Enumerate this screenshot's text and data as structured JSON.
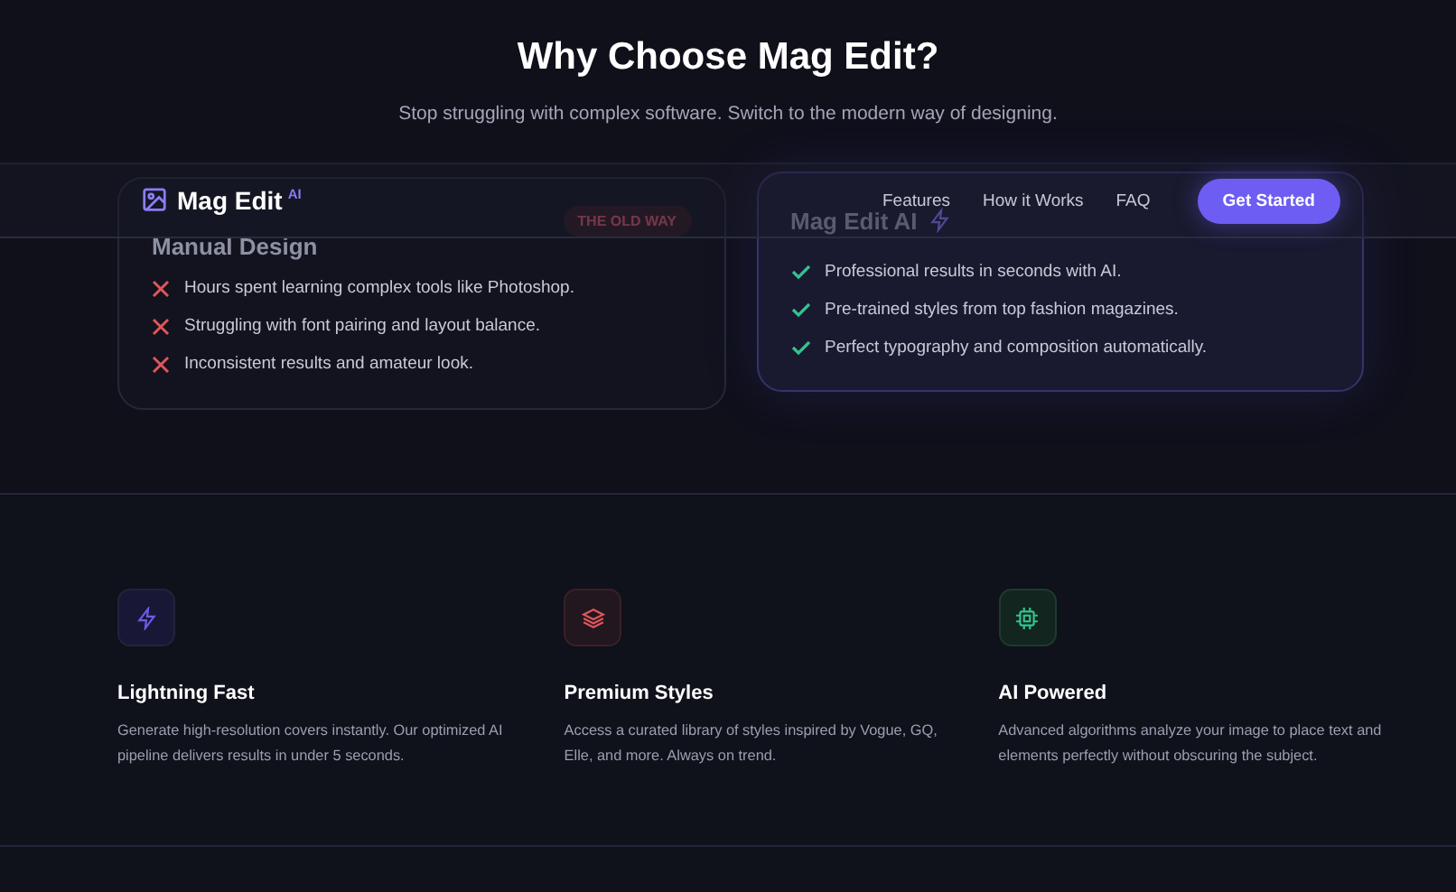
{
  "header": {
    "title": "Why Choose Mag Edit?",
    "subtitle": "Stop struggling with complex software. Switch to the modern way of designing."
  },
  "navbar": {
    "brand": "Mag Edit",
    "brand_tag": "AI",
    "links": [
      "Features",
      "How it Works",
      "FAQ"
    ],
    "cta": "Get Started"
  },
  "comparison": [
    {
      "kind": "old",
      "badge": "THE OLD WAY",
      "title": "Manual Design",
      "items": [
        "Hours spent learning complex tools like Photoshop.",
        "Struggling with font pairing and layout balance.",
        "Inconsistent results and amateur look."
      ]
    },
    {
      "kind": "new",
      "title": "Mag Edit AI",
      "items": [
        "Professional results in seconds with AI.",
        "Pre-trained styles from top fashion magazines.",
        "Perfect typography and composition automatically."
      ]
    }
  ],
  "features": [
    {
      "kind": "bolt",
      "title": "Lightning Fast",
      "text": "Generate high-resolution covers instantly. Our optimized AI pipeline delivers results in under 5 seconds."
    },
    {
      "kind": "layers",
      "title": "Premium Styles",
      "text": "Access a curated library of styles inspired by Vogue, GQ, Elle, and more. Always on trend."
    },
    {
      "kind": "chip",
      "title": "AI Powered",
      "text": "Advanced algorithms analyze your image to place text and elements perfectly without obscuring the subject."
    }
  ]
}
